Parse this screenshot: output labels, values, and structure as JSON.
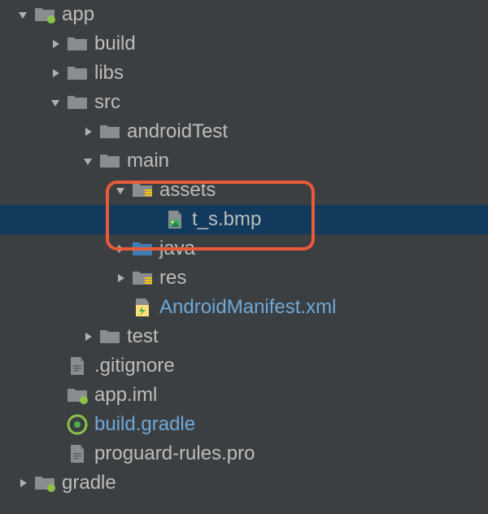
{
  "tree": {
    "app": "app",
    "build": "build",
    "libs": "libs",
    "src": "src",
    "androidTest": "androidTest",
    "main": "main",
    "assets": "assets",
    "t_s_bmp": "t_s.bmp",
    "java": "java",
    "res": "res",
    "manifest": "AndroidManifest.xml",
    "test": "test",
    "gitignore": ".gitignore",
    "app_iml": "app.iml",
    "build_gradle": "build.gradle",
    "proguard": "proguard-rules.pro",
    "gradle": "gradle"
  }
}
